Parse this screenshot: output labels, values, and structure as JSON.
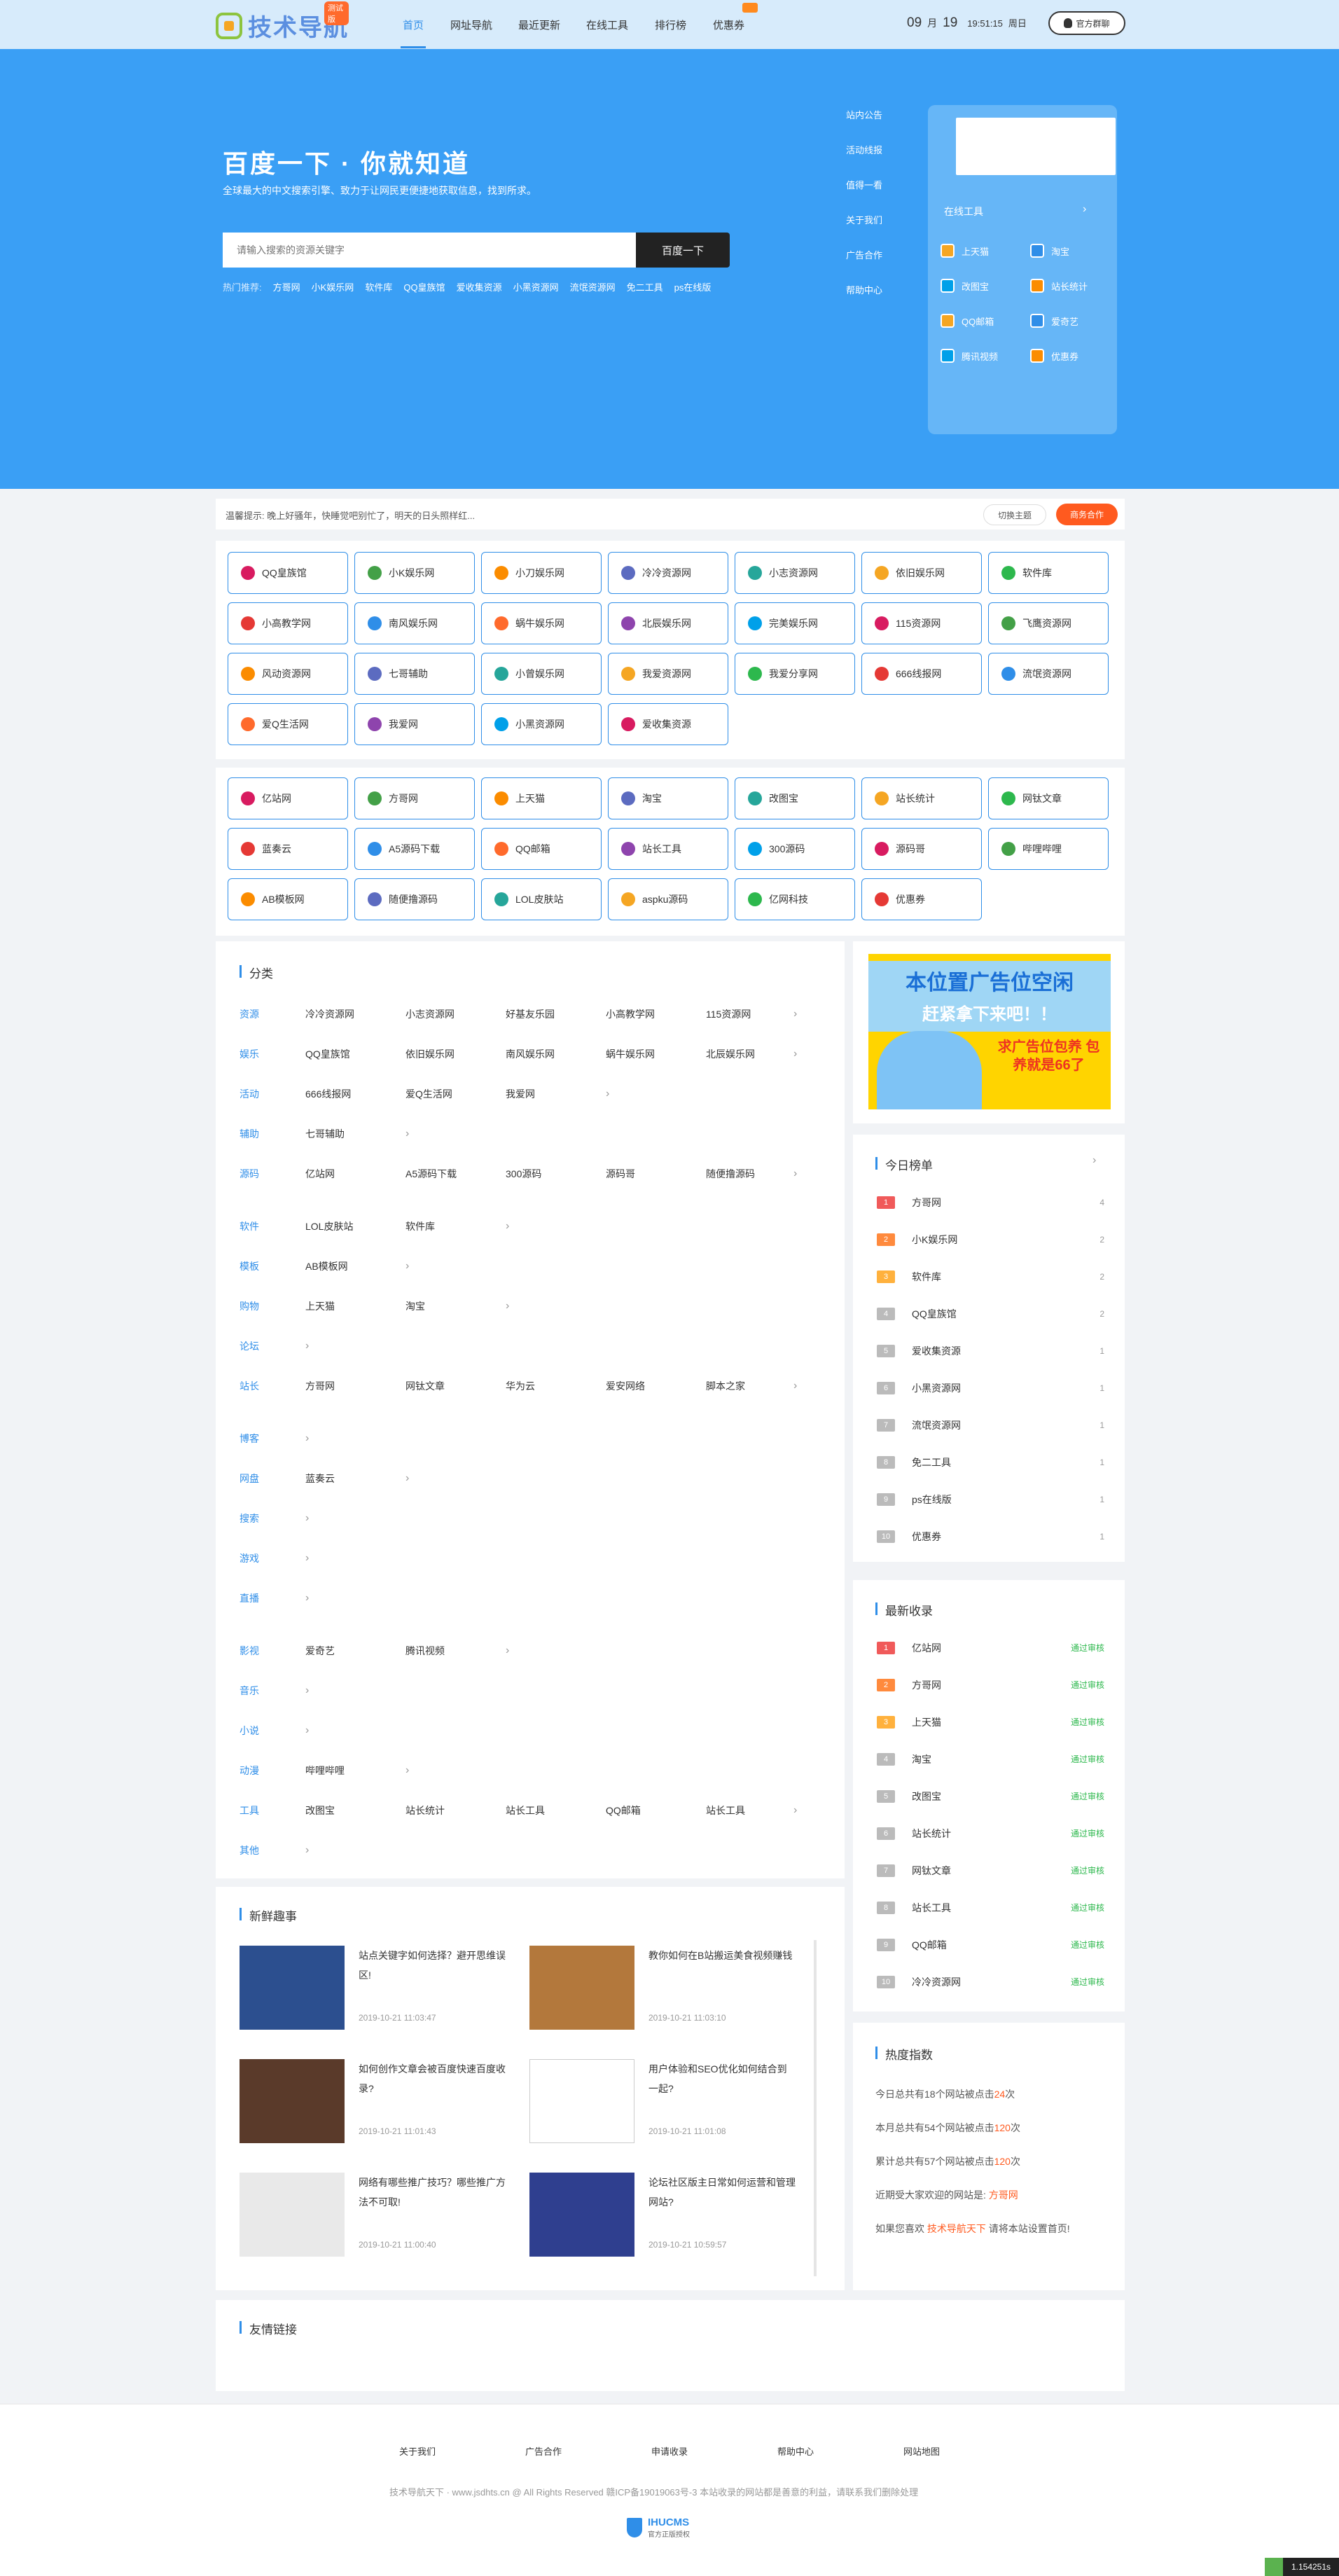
{
  "header": {
    "logo_text": "技术导航",
    "logo_badge": "测试版",
    "nav": [
      "首页",
      "网址导航",
      "最近更新",
      "在线工具",
      "排行榜",
      "优惠券"
    ],
    "date_month": "09",
    "month_label": "月",
    "date_day": "19",
    "time": "19:51:15",
    "weekday": "周日",
    "qq_group": "官方群聊"
  },
  "hero": {
    "title": "百度一下 · 你就知道",
    "subtitle": "全球最大的中文搜索引擎、致力于让网民更便捷地获取信息，找到所求。",
    "search_placeholder": "请输入搜索的资源关键字",
    "search_button": "百度一下",
    "hot_label": "热门推荐:",
    "hot_words": [
      "方哥网",
      "小K娱乐网",
      "软件库",
      "QQ皇族馆",
      "爱收集资源",
      "小黑资源网",
      "流氓资源网",
      "免二工具",
      "ps在线版"
    ],
    "side_links": [
      "站内公告",
      "活动线报",
      "值得一看",
      "关于我们",
      "广告合作",
      "帮助中心"
    ],
    "tools_title": "在线工具",
    "tools_arrow": "›",
    "tools": [
      "上天猫",
      "淘宝",
      "改图宝",
      "站长统计",
      "QQ邮箱",
      "爱奇艺",
      "腾讯视频",
      "优惠券"
    ]
  },
  "notice": {
    "text": "温馨提示:  晚上好骚年，快睡觉吧别忙了，明天的日头照样红...",
    "theme_button": "切换主题",
    "coop_button": "商务合作"
  },
  "sites_a": [
    "QQ皇族馆",
    "小K娱乐网",
    "小刀娱乐网",
    "冷冷资源网",
    "小志资源网",
    "依旧娱乐网",
    "软件库",
    "小高教学网",
    "南风娱乐网",
    "蜗牛娱乐网",
    "北辰娱乐网",
    "完美娱乐网",
    "115资源网",
    "飞鹰资源网",
    "风动资源网",
    "七哥辅助",
    "小曾娱乐网",
    "我爱资源网",
    "我爱分享网",
    "666线报网",
    "流氓资源网",
    "爱Q生活网",
    "我爱网",
    "小黑资源网",
    "爱收集资源"
  ],
  "sites_b": [
    "亿站网",
    "方哥网",
    "上天猫",
    "淘宝",
    "改图宝",
    "站长统计",
    "网钛文章",
    "蓝奏云",
    "A5源码下载",
    "QQ邮箱",
    "站长工具",
    "300源码",
    "源码哥",
    "哔哩哔哩",
    "AB模板网",
    "随便撸源码",
    "LOL皮肤站",
    "aspku源码",
    "亿网科技",
    "优惠券"
  ],
  "category": {
    "title": "分类",
    "arrow": "›",
    "rows": [
      {
        "name": "资源",
        "items": [
          "冷冷资源网",
          "小志资源网",
          "好基友乐园",
          "小高教学网",
          "115资源网"
        ]
      },
      {
        "name": "娱乐",
        "items": [
          "QQ皇族馆",
          "依旧娱乐网",
          "南风娱乐网",
          "蜗牛娱乐网",
          "北辰娱乐网"
        ]
      },
      {
        "name": "活动",
        "items": [
          "666线报网",
          "爱Q生活网",
          "我爱网"
        ]
      },
      {
        "name": "辅助",
        "items": [
          "七哥辅助"
        ]
      },
      {
        "name": "源码",
        "items": [
          "亿站网",
          "A5源码下载",
          "300源码",
          "源码哥",
          "随便撸源码"
        ]
      },
      {
        "name": "软件",
        "items": [
          "LOL皮肤站",
          "软件库"
        ]
      },
      {
        "name": "模板",
        "items": [
          "AB模板网"
        ]
      },
      {
        "name": "购物",
        "items": [
          "上天猫",
          "淘宝"
        ]
      },
      {
        "name": "论坛",
        "items": []
      },
      {
        "name": "站长",
        "items": [
          "方哥网",
          "网钛文章",
          "华为云",
          "爱安网络",
          "脚本之家"
        ]
      },
      {
        "name": "博客",
        "items": []
      },
      {
        "name": "网盘",
        "items": [
          "蓝奏云"
        ]
      },
      {
        "name": "搜索",
        "items": []
      },
      {
        "name": "游戏",
        "items": []
      },
      {
        "name": "直播",
        "items": []
      },
      {
        "name": "影视",
        "items": [
          "爱奇艺",
          "腾讯视频"
        ]
      },
      {
        "name": "音乐",
        "items": []
      },
      {
        "name": "小说",
        "items": []
      },
      {
        "name": "动漫",
        "items": [
          "哔哩哔哩"
        ]
      },
      {
        "name": "工具",
        "items": [
          "改图宝",
          "站长统计",
          "站长工具",
          "QQ邮箱",
          "站长工具"
        ]
      },
      {
        "name": "其他",
        "items": []
      }
    ]
  },
  "news": {
    "title": "新鲜趣事",
    "items": [
      {
        "title": "站点关键字如何选择？避开思维误区!",
        "time": "2019-10-21 11:03:47"
      },
      {
        "title": "教你如何在B站搬运美食视频赚钱",
        "time": "2019-10-21 11:03:10"
      },
      {
        "title": "如何创作文章会被百度快速百度收录?",
        "time": "2019-10-21 11:01:43"
      },
      {
        "title": "用户体验和SEO优化如何结合到一起?",
        "time": "2019-10-21 11:01:08"
      },
      {
        "title": "网络有哪些推广技巧？哪些推广方法不可取!",
        "time": "2019-10-21 11:00:40"
      },
      {
        "title": "论坛社区版主日常如何运营和管理网站?",
        "time": "2019-10-21 10:59:57"
      }
    ]
  },
  "ad": {
    "line1": "本位置广告位空闲",
    "line2": "赶紧拿下来吧！！",
    "line3": "求广告位包养 包养就是66了"
  },
  "today_rank": {
    "title": "今日榜单",
    "arrow": "›",
    "items": [
      {
        "no": "1",
        "name": "方哥网",
        "count": "4"
      },
      {
        "no": "2",
        "name": "小K娱乐网",
        "count": "2"
      },
      {
        "no": "3",
        "name": "软件库",
        "count": "2"
      },
      {
        "no": "4",
        "name": "QQ皇族馆",
        "count": "2"
      },
      {
        "no": "5",
        "name": "爱收集资源",
        "count": "1"
      },
      {
        "no": "6",
        "name": "小黑资源网",
        "count": "1"
      },
      {
        "no": "7",
        "name": "流氓资源网",
        "count": "1"
      },
      {
        "no": "8",
        "name": "免二工具",
        "count": "1"
      },
      {
        "no": "9",
        "name": "ps在线版",
        "count": "1"
      },
      {
        "no": "10",
        "name": "优惠券",
        "count": "1"
      }
    ]
  },
  "latest": {
    "title": "最新收录",
    "status": "通过审核",
    "items": [
      {
        "no": "1",
        "name": "亿站网"
      },
      {
        "no": "2",
        "name": "方哥网"
      },
      {
        "no": "3",
        "name": "上天猫"
      },
      {
        "no": "4",
        "name": "淘宝"
      },
      {
        "no": "5",
        "name": "改图宝"
      },
      {
        "no": "6",
        "name": "站长统计"
      },
      {
        "no": "7",
        "name": "网钛文章"
      },
      {
        "no": "8",
        "name": "站长工具"
      },
      {
        "no": "9",
        "name": "QQ邮箱"
      },
      {
        "no": "10",
        "name": "冷冷资源网"
      }
    ]
  },
  "heat": {
    "title": "热度指数",
    "l1a": "今日总共有18个网站被点击",
    "l1b": "24",
    "l1c": "次",
    "l2a": "本月总共有54个网站被点击",
    "l2b": "120",
    "l2c": "次",
    "l3a": "累计总共有57个网站被点击",
    "l3b": "120",
    "l3c": "次",
    "l4a": "近期受大家欢迎的网站是: ",
    "l4b": "方哥网",
    "l5a": "如果您喜欢 ",
    "l5b": "技术导航天下",
    "l5c": " 请将本站设置首页!"
  },
  "friend_links": {
    "title": "友情链接"
  },
  "footer": {
    "links": [
      "关于我们",
      "广告合作",
      "申请收录",
      "帮助中心",
      "网站地图"
    ],
    "copyright": "技术导航天下 · www.jsdhts.cn @ All Rights Reserved   赣ICP备19019063号-3  本站收录的网站都是善意的利益，请联系我们删除处理",
    "brand": "IHUCMS",
    "brand_sub": "官方正版授权",
    "perf": "1.154251s"
  },
  "colors": {
    "accent": "#2f8ee8",
    "hero_bg": "#3a9ff5",
    "header_bg": "#d7ebfb",
    "orange": "#ff5a1f",
    "green": "#2db84d"
  }
}
